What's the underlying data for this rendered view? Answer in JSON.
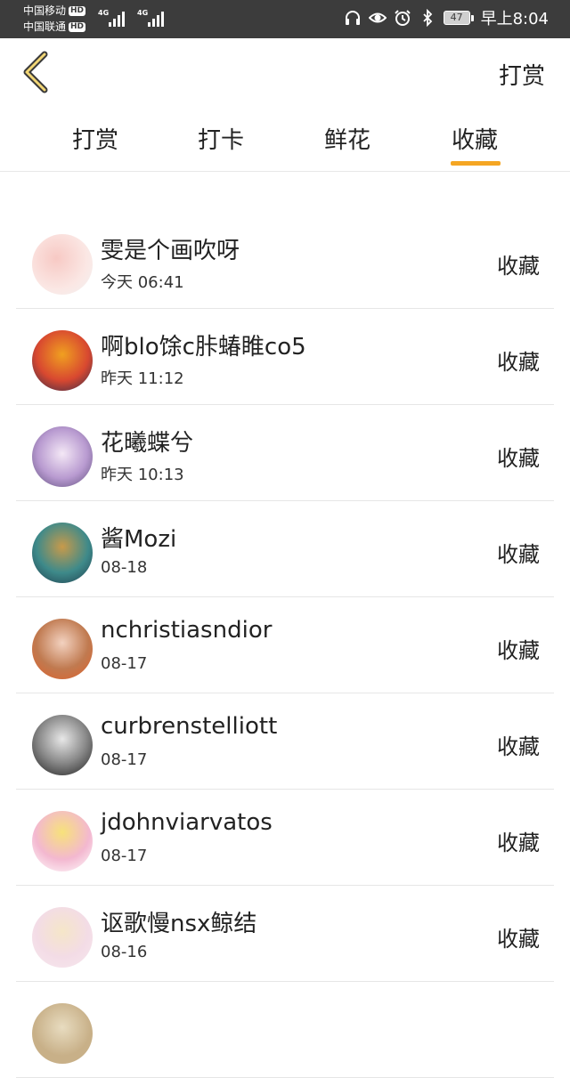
{
  "status_bar": {
    "carrier1": "中国移动",
    "carrier2": "中国联通",
    "hd_label": "HD",
    "network1": "4G",
    "network2": "4G",
    "battery": "47",
    "time": "早上8:04"
  },
  "header": {
    "title": "打赏",
    "back_icon": "chevron-left-icon",
    "accent": "#f5a623"
  },
  "tabs": [
    {
      "label": "打赏",
      "active": false
    },
    {
      "label": "打卡",
      "active": false
    },
    {
      "label": "鲜花",
      "active": false
    },
    {
      "label": "收藏",
      "active": true
    }
  ],
  "list": [
    {
      "name": "雯是个画吹呀",
      "time": "今天 06:41",
      "action": "收藏"
    },
    {
      "name": "啊blo馀c胩蝽睢co5",
      "time": "昨天 11:12",
      "action": "收藏"
    },
    {
      "name": "花曦蝶兮",
      "time": "昨天 10:13",
      "action": "收藏"
    },
    {
      "name": "酱Mozi",
      "time": "08-18",
      "action": "收藏"
    },
    {
      "name": "nchristiasndior",
      "time": "08-17",
      "action": "收藏"
    },
    {
      "name": "curbrenstelliott",
      "time": "08-17",
      "action": "收藏"
    },
    {
      "name": "jdohnviarvatos",
      "time": "08-17",
      "action": "收藏"
    },
    {
      "name": "讴歌慢nsx鲸结",
      "time": "08-16",
      "action": "收藏"
    }
  ]
}
